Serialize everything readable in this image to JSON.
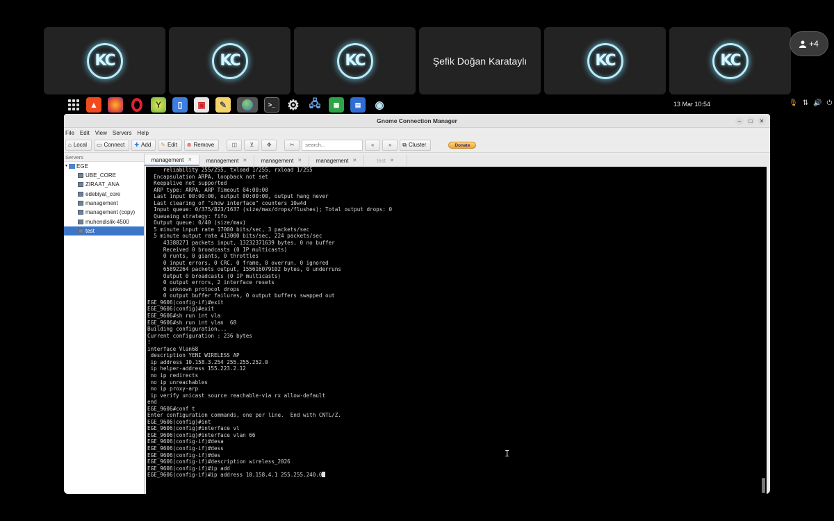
{
  "call": {
    "participants": [
      {
        "name": "",
        "logo": "KC"
      },
      {
        "name": "",
        "logo": "KC"
      },
      {
        "name": "",
        "logo": "KC"
      },
      {
        "name": "Şefik Doğan Karataylı",
        "logo": ""
      },
      {
        "name": "",
        "logo": "KC"
      },
      {
        "name": "",
        "logo": "KC"
      }
    ],
    "more_count": "+4"
  },
  "desktop": {
    "clock": "13 Mar  10:54",
    "apps": [
      "brave-icon",
      "firefox-icon",
      "opera-icon",
      "yandex-icon",
      "notes-icon",
      "software-store-icon",
      "text-editor-icon",
      "gnome-connection-manager-icon",
      "terminal-icon",
      "settings-icon",
      "network-icon",
      "spreadsheet-icon",
      "document-icon",
      "eye-icon"
    ]
  },
  "window": {
    "title": "Gnome Connection Manager",
    "menu": [
      "File",
      "Edit",
      "View",
      "Servers",
      "Help"
    ],
    "toolbar": {
      "local": "Local",
      "connect": "Connect",
      "add": "Add",
      "edit": "Edit",
      "remove": "Remove",
      "search_placeholder": "search...",
      "cluster": "Cluster",
      "donate": "Donate"
    },
    "servers_header": "Servers",
    "tree_root": "EGE",
    "servers": [
      "UBE_CORE",
      "ZIRAAT_ANA",
      "edebiyat_core",
      "management",
      "management (copy)",
      "muhendislik-4500",
      "test"
    ],
    "selected_server": "test",
    "tabs": [
      "management",
      "management",
      "management",
      "management",
      "test"
    ]
  },
  "terminal": {
    "lines": [
      "     reliability 255/255, txload 1/255, rxload 1/255",
      "  Encapsulation ARPA, loopback not set",
      "  Keepalive not supported",
      "  ARP type: ARPA, ARP Timeout 04:00:00",
      "  Last input 00:00:00, output 00:00:00, output hang never",
      "  Last clearing of \"show interface\" counters 10w4d",
      "  Input queue: 0/375/823/1637 (size/max/drops/flushes); Total output drops: 0",
      "  Queueing strategy: fifo",
      "  Output queue: 0/40 (size/max)",
      "  5 minute input rate 17000 bits/sec, 3 packets/sec",
      "  5 minute output rate 413000 bits/sec, 224 packets/sec",
      "     43388271 packets input, 13232371639 bytes, 0 no buffer",
      "     Received 0 broadcasts (0 IP multicasts)",
      "     0 runts, 0 giants, 0 throttles",
      "     0 input errors, 0 CRC, 0 frame, 0 overrun, 0 ignored",
      "     65892264 packets output, 155616079102 bytes, 0 underruns",
      "     Output 0 broadcasts (0 IP multicasts)",
      "     0 output errors, 2 interface resets",
      "     0 unknown protocol drops",
      "     0 output buffer failures, 0 output buffers swapped out",
      "EGE_9606(config-if)#exit",
      "EGE_9606(config)#exit",
      "EGE_9606#sh run int vla",
      "EGE_9606#sh run int vlan  68",
      "Building configuration...",
      "",
      "Current configuration : 236 bytes",
      "!",
      "interface Vlan68",
      " description YENI WIRELESS AP",
      " ip address 10.158.3.254 255.255.252.0",
      " ip helper-address 155.223.2.12",
      " no ip redirects",
      " no ip unreachables",
      " no ip proxy-arp",
      " ip verify unicast source reachable-via rx allow-default",
      "end",
      "",
      "EGE_9606#conf t",
      "Enter configuration commands, one per line.  End with CNTL/Z.",
      "EGE_9606(config)#int",
      "EGE_9606(config)#interface vl",
      "EGE_9606(config)#interface vlan 66",
      "EGE_9606(config-if)#desa",
      "EGE_9606(config-if)#dess",
      "EGE_9606(config-if)#des",
      "EGE_9606(config-if)#description wireless_2026",
      "EGE_9606(config-if)#ip add",
      "EGE_9606(config-if)#ip address 10.158.4.1 255.255.240.0"
    ]
  }
}
